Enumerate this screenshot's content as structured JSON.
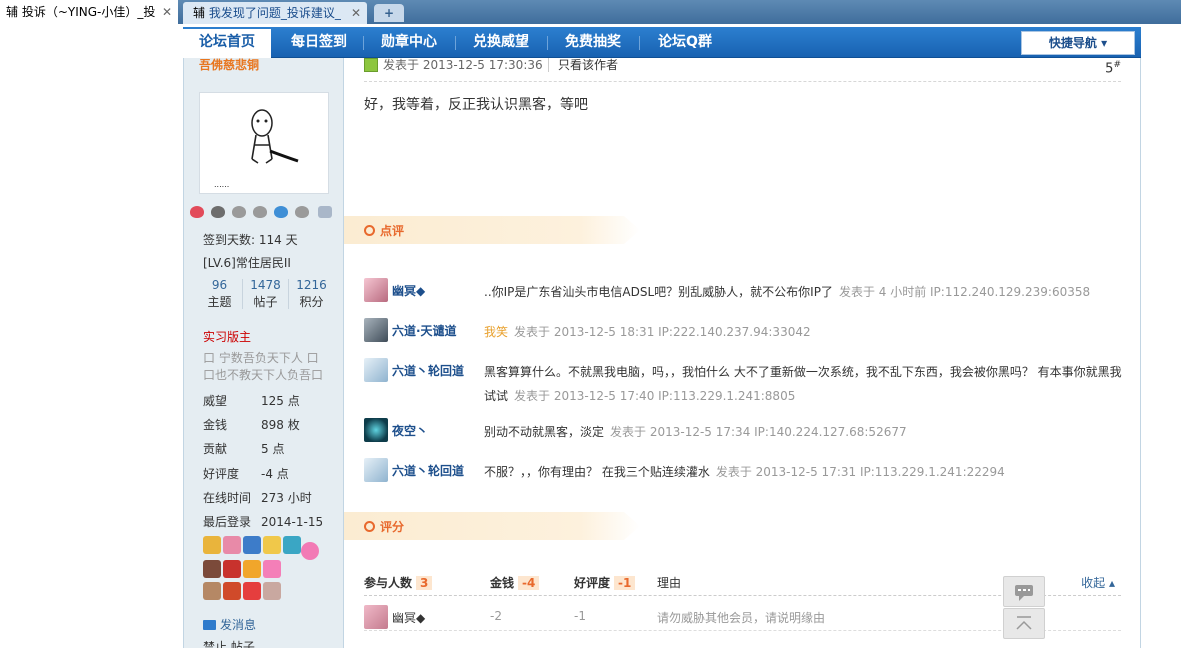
{
  "browser": {
    "tabs": [
      {
        "icon_text": "辅",
        "label": "投诉（~YING-小佳）_投",
        "close": "✕"
      },
      {
        "icon_text": "辅",
        "label": "我发现了问题_投诉建议_",
        "close": "✕"
      }
    ],
    "new_tab": "+"
  },
  "nav": {
    "items": [
      "论坛首页",
      "每日签到",
      "勋章中心",
      "兑换威望",
      "免费抽奖",
      "论坛Q群"
    ],
    "quick_nav": "快捷导航 ▾"
  },
  "sidebar": {
    "username": "吾佛慈悲铜",
    "checkin": "签到天数: 114 天",
    "level": "[LV.6]常住居民II",
    "stats": [
      {
        "num": "96",
        "label": "主题"
      },
      {
        "num": "1478",
        "label": "帖子"
      },
      {
        "num": "1216",
        "label": "积分"
      }
    ],
    "role": "实习版主",
    "motto": "口 宁数吾负天下人 口 口也不教天下人负吾口",
    "fields": [
      {
        "k": "威望",
        "v": "125 点"
      },
      {
        "k": "金钱",
        "v": "898 枚"
      },
      {
        "k": "贡献",
        "v": "5 点"
      },
      {
        "k": "好评度",
        "v": "-4 点"
      },
      {
        "k": "在线时间",
        "v": "273 小时"
      },
      {
        "k": "最后登录",
        "v": "2014-1-15"
      }
    ],
    "send_msg": "发消息",
    "ban_post": "禁止 帖子"
  },
  "post": {
    "time": "发表于 2013-12-5 17:30:36",
    "view_author": "只看该作者",
    "floor": "5",
    "floor_sup": "#",
    "content": "好，我等着，反正我认识黑客，等吧"
  },
  "comments_section": {
    "title": "点评",
    "items": [
      {
        "name": "幽冥◆",
        "text": "..你IP是广东省汕头市电信ADSL吧？别乱威胁人，就不公布你IP了",
        "meta": "发表于 4 小时前 IP:112.240.129.239:60358",
        "color": "#c98a9a"
      },
      {
        "name": "六道·天谴道",
        "text": "",
        "laugh": "我笑",
        "meta": "发表于 2013-12-5 18:31 IP:222.140.237.94:33042",
        "color": "#5a6a78"
      },
      {
        "name": "六道丶轮回道",
        "text": "黑客算算什么。不就黑我电脑，吗，，我怕什么 大不了重新做一次系统，我不乱下东西，我会被你黑吗？ 有本事你就黑我试试",
        "meta": "发表于 2013-12-5 17:40 IP:113.229.1.241:8805",
        "color": "#9ab8cf"
      },
      {
        "name": "夜空丶",
        "text": "别动不动就黑客，淡定",
        "meta": "发表于 2013-12-5 17:34 IP:140.224.127.68:52677",
        "color": "#1b4f5e"
      },
      {
        "name": "六道丶轮回道",
        "text": "不服？，，你有理由？ 在我三个贴连续灌水",
        "meta": "发表于 2013-12-5 17:31 IP:113.229.1.241:22294",
        "color": "#9ab8cf"
      }
    ]
  },
  "rating_section": {
    "title": "评分",
    "head": {
      "participants_label": "参与人数",
      "participants": "3",
      "money_label": "金钱",
      "money": "-4",
      "rep_label": "好评度",
      "rep": "-1",
      "reason_label": "理由",
      "collapse": "收起 ▴"
    },
    "row": {
      "name": "幽冥◆",
      "money": "-2",
      "rep": "-1",
      "reason": "请勿威胁其他会员，请说明缘由"
    }
  }
}
